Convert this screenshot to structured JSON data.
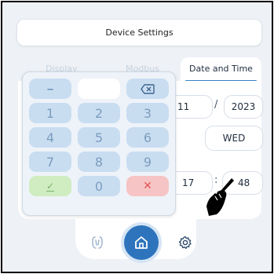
{
  "header": {
    "title": "Device Settings"
  },
  "tabs": [
    {
      "label": "Display"
    },
    {
      "label": "Modbus"
    },
    {
      "label": "Date and Time"
    }
  ],
  "date": {
    "day": "11",
    "separator": "/",
    "year": "2023",
    "weekday": "WED"
  },
  "time": {
    "hour": "17",
    "separator": ":",
    "minute": "48"
  },
  "keypad": {
    "minus": "–",
    "display_value": "",
    "backspace": "⌫",
    "digits": [
      "1",
      "2",
      "3",
      "4",
      "5",
      "6",
      "7",
      "8",
      "9",
      "0"
    ],
    "confirm": "✓",
    "cancel": "✕"
  },
  "nav": {
    "left_icon": "link-icon",
    "center_icon": "home-icon",
    "right_icon": "gear-icon"
  },
  "colors": {
    "accent": "#2e74bd",
    "confirm": "#cfedc0",
    "cancel": "#f6c4c4",
    "key": "#c9ddf1"
  }
}
